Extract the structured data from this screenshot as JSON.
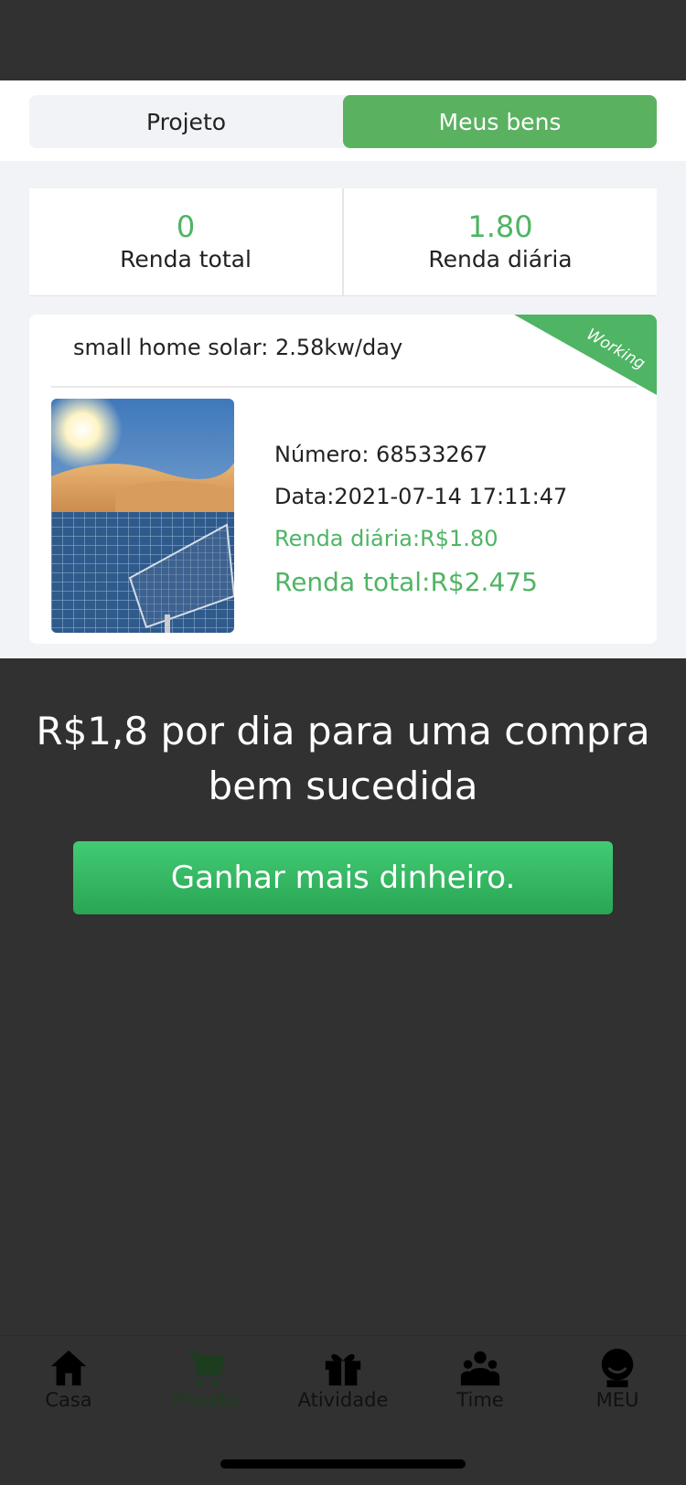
{
  "tabs": {
    "project": "Projeto",
    "assets": "Meus bens"
  },
  "stats": {
    "total_value": "0",
    "total_label": "Renda total",
    "daily_value": "1.80",
    "daily_label": "Renda diária"
  },
  "card": {
    "title": "small home solar: 2.58kw/day",
    "status": "Working",
    "number": "Número: 68533267",
    "date": "Data:2021-07-14 17:11:47",
    "daily": "Renda diária:R$1.80",
    "total": "Renda total:R$2.475"
  },
  "promo": {
    "line1": "R$1,8 por dia para uma compra",
    "line2": "bem sucedida",
    "button": "Ganhar mais dinheiro."
  },
  "nav": [
    "Casa",
    "Projeto",
    "Atividade",
    "Time",
    "MEU"
  ],
  "colors": {
    "accent": "#5ab160",
    "green_text": "#4fb464",
    "dark_bg": "#313131"
  }
}
